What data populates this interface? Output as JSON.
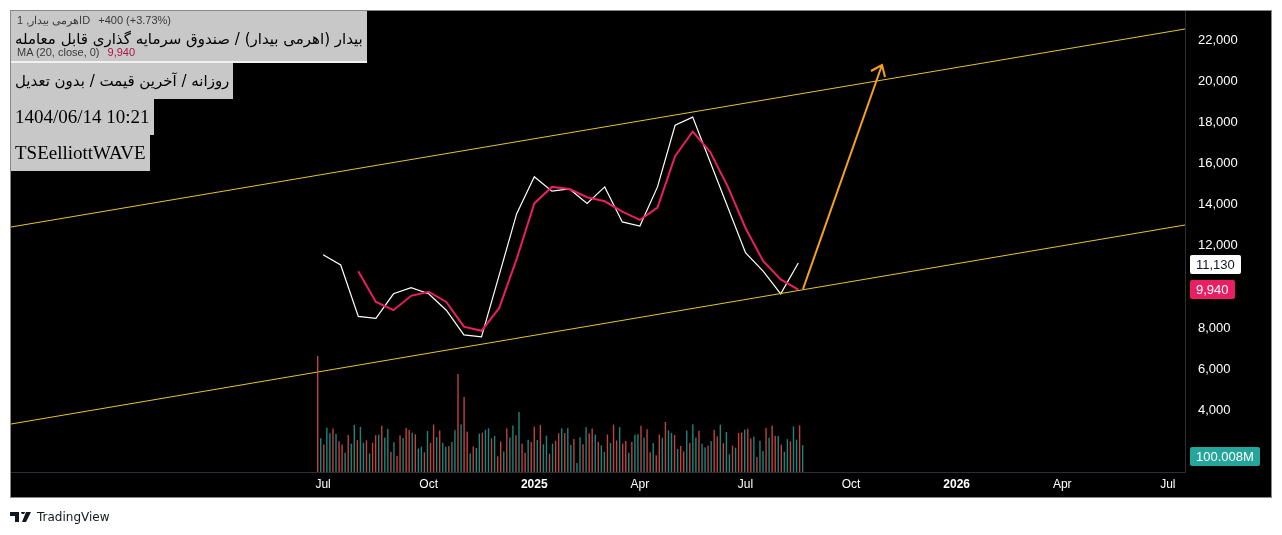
{
  "overlay_notes": [
    {
      "text": "بیدار (اهرمی بیدار) / صندوق سرمایه گذاری قابل معامله",
      "kind": "rtl"
    },
    {
      "text": "روزانه / آخرین قیمت / بدون تعدیل",
      "kind": "rtl"
    },
    {
      "text": "1404/06/14 10:21",
      "kind": "ltr"
    },
    {
      "text": "TSEelliottWAVE",
      "kind": "ltr"
    }
  ],
  "legend": {
    "symbol": "اهرمی بیدار, 1D",
    "change": "+400 (+3.73%)",
    "ma_value": "9,940"
  },
  "chart_data": {
    "type": "line",
    "xlim": [
      2023.761,
      2026.543
    ],
    "ylim": [
      878,
      23363
    ],
    "x": [
      2024.5,
      2024.5417,
      2024.5833,
      2024.625,
      2024.6667,
      2024.7083,
      2024.75,
      2024.7917,
      2024.8333,
      2024.875,
      2024.9167,
      2024.9583,
      2025.0,
      2025.0417,
      2025.0833,
      2025.125,
      2025.1667,
      2025.2083,
      2025.25,
      2025.2917,
      2025.3333,
      2025.375,
      2025.4167,
      2025.4583,
      2025.5,
      2025.5417,
      2025.5833,
      2025.625
    ],
    "series": [
      {
        "color": "#ffffff",
        "values": [
          11500,
          11000,
          8500,
          8400,
          9600,
          9900,
          9600,
          8800,
          7600,
          7500,
          10500,
          13500,
          15300,
          14600,
          14700,
          14000,
          14800,
          13100,
          12900,
          14800,
          17800,
          18200,
          16000,
          13800,
          11600,
          10700,
          9600,
          11100
        ]
      },
      {
        "name": "MA (20, close, 0)",
        "color": "#e91e63",
        "values": [
          null,
          null,
          10700,
          9200,
          8800,
          9500,
          9700,
          9200,
          8000,
          7800,
          8900,
          11300,
          14000,
          14800,
          14700,
          14300,
          14100,
          13600,
          13200,
          13800,
          16300,
          17500,
          16500,
          14800,
          12800,
          11200,
          10300,
          9800
        ]
      }
    ],
    "xticks": [
      {
        "value": 2024.5,
        "label": "Jul"
      },
      {
        "value": 2024.75,
        "label": "Oct"
      },
      {
        "value": 2025,
        "label": "2025"
      },
      {
        "value": 2025.25,
        "label": "Apr"
      },
      {
        "value": 2025.5,
        "label": "Jul"
      },
      {
        "value": 2025.75,
        "label": "Oct"
      },
      {
        "value": 2026,
        "label": "2026"
      },
      {
        "value": 2026.25,
        "label": "Apr"
      },
      {
        "value": 2026.5,
        "label": "Jul"
      }
    ],
    "yticks": [
      {
        "value": 4000,
        "label": "4,000"
      },
      {
        "value": 6000,
        "label": "6,000"
      },
      {
        "value": 8000,
        "label": "8,000"
      },
      {
        "value": 12000,
        "label": "12,000"
      },
      {
        "value": 14000,
        "label": "14,000"
      },
      {
        "value": 16000,
        "label": "16,000"
      },
      {
        "value": 18000,
        "label": "18,000"
      },
      {
        "value": 20000,
        "label": "20,000"
      },
      {
        "value": 22000,
        "label": "22,000"
      }
    ]
  },
  "price_labels": [
    {
      "text": "11,130",
      "kind": "last"
    },
    {
      "text": "9,940",
      "kind": "ma"
    },
    {
      "text": "100.008M",
      "kind": "volume"
    }
  ],
  "footer": {
    "brand": "TradingView"
  }
}
